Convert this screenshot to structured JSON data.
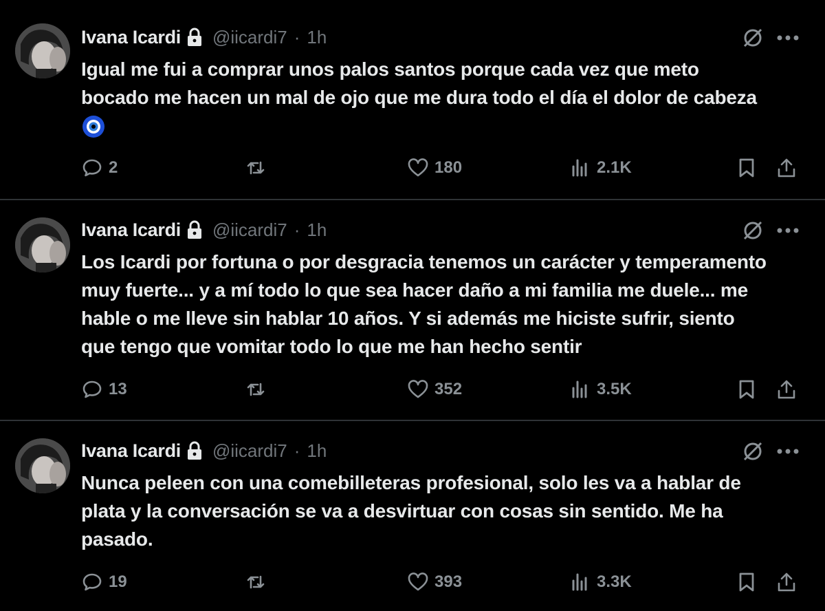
{
  "tweets": [
    {
      "author": {
        "name": "Ivana Icardi",
        "handle": "@iicardi7",
        "time": "1h",
        "protected": true
      },
      "text": "Igual me fui a comprar unos palos santos porque cada vez que meto\nbocado me hacen un mal de ojo que me dura todo el día el dolor de cabeza",
      "emoji": "nazar-amulet-icon",
      "stats": {
        "replies": "2",
        "retweets": "",
        "likes": "180",
        "views": "2.1K"
      }
    },
    {
      "author": {
        "name": "Ivana Icardi",
        "handle": "@iicardi7",
        "time": "1h",
        "protected": true
      },
      "text": "Los Icardi por fortuna o por desgracia tenemos un carácter y temperamento\nmuy fuerte... y a mí todo lo que sea hacer daño a mi familia me duele... me\nhable o me lleve sin hablar 10 años. Y si además me hiciste sufrir, siento\nque tengo que vomitar todo lo que me han hecho sentir",
      "stats": {
        "replies": "13",
        "retweets": "",
        "likes": "352",
        "views": "3.5K"
      }
    },
    {
      "author": {
        "name": "Ivana Icardi",
        "handle": "@iicardi7",
        "time": "1h",
        "protected": true
      },
      "text": "Nunca peleen con una comebilleteras profesional, solo les va a hablar de\nplata y la conversación se va a desvirtuar con cosas sin sentido. Me ha\npasado.",
      "stats": {
        "replies": "19",
        "retweets": "",
        "likes": "393",
        "views": "3.3K"
      }
    }
  ],
  "separator": "·",
  "colors": {
    "background": "#000000",
    "text": "#e7e9ea",
    "muted": "#71767b",
    "divider": "#2f3336"
  }
}
